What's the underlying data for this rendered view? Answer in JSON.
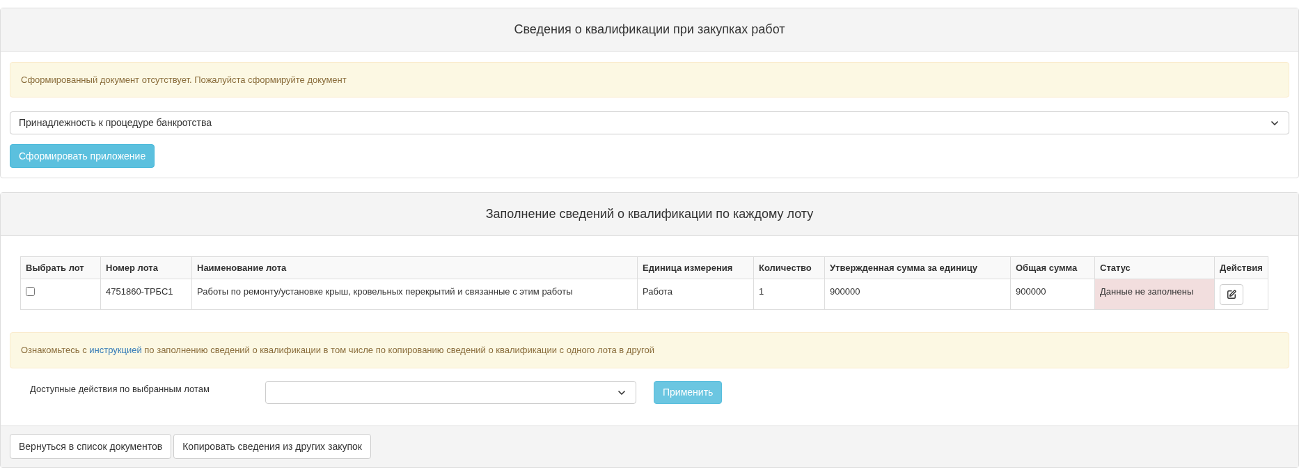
{
  "qualification_panel": {
    "title": "Сведения о квалификации при закупках работ",
    "alert": "Сформированный документ отсутствует. Пожалуйста сформируйте документ",
    "select": {
      "value": "Принадлежность к процедуре банкротства"
    },
    "button": "Сформировать приложение"
  },
  "lots_panel": {
    "title": "Заполнение сведений о квалификации по каждому лоту",
    "table": {
      "columns": [
        "Выбрать лот",
        "Номер лота",
        "Наименование лота",
        "Единица измерения",
        "Количество",
        "Утвержденная сумма за единицу",
        "Общая сумма",
        "Статус",
        "Действия"
      ],
      "rows": [
        {
          "checked": false,
          "lot_number": "4751860-ТРБС1",
          "lot_name": "Работы по ремонту/установке крыш, кровельных перекрытий и связанные с этим работы",
          "unit": "Работа",
          "quantity": "1",
          "unit_price": "900000",
          "total": "900000",
          "status": {
            "label": "Данные не заполнены",
            "kind": "danger"
          }
        }
      ]
    },
    "info": {
      "before": "Ознакомьтесь с",
      "link": "инструкцией",
      "after": "по заполнению сведений о квалификации в том числе по копированию сведений о квалификации с одного лота в другой"
    },
    "actions_label": "Доступные действия по выбранным лотам",
    "apply_button": "Применить"
  },
  "footer_buttons": [
    "Вернуться в список документов",
    "Копировать сведения из других закупок"
  ]
}
